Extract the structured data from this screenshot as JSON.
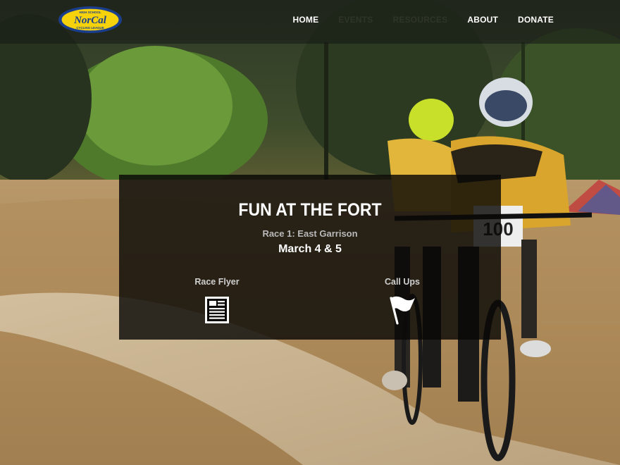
{
  "header": {
    "logo_text": "NorCal",
    "logo_top_text": "HIGH SCHOOL",
    "logo_bottom_text": "CYCLING LEAGUE",
    "nav": [
      {
        "label": "HOME",
        "dim": false
      },
      {
        "label": "EVENTS",
        "dim": true
      },
      {
        "label": "RESOURCES",
        "dim": true
      },
      {
        "label": "ABOUT",
        "dim": false
      },
      {
        "label": "DONATE",
        "dim": false
      }
    ]
  },
  "event": {
    "title": "FUN AT THE FORT",
    "subtitle": "Race 1: East Garrison",
    "date": "March 4 & 5",
    "links": {
      "flyer_label": "Race Flyer",
      "callups_label": "Call Ups"
    }
  },
  "hero": {
    "bib_number": "100"
  },
  "colors": {
    "logo_yellow": "#f5d20c",
    "logo_blue": "#1a3e8c",
    "card_bg": "#0a0806"
  },
  "icons": {
    "flyer": "document-icon",
    "callups": "flag-icon"
  }
}
